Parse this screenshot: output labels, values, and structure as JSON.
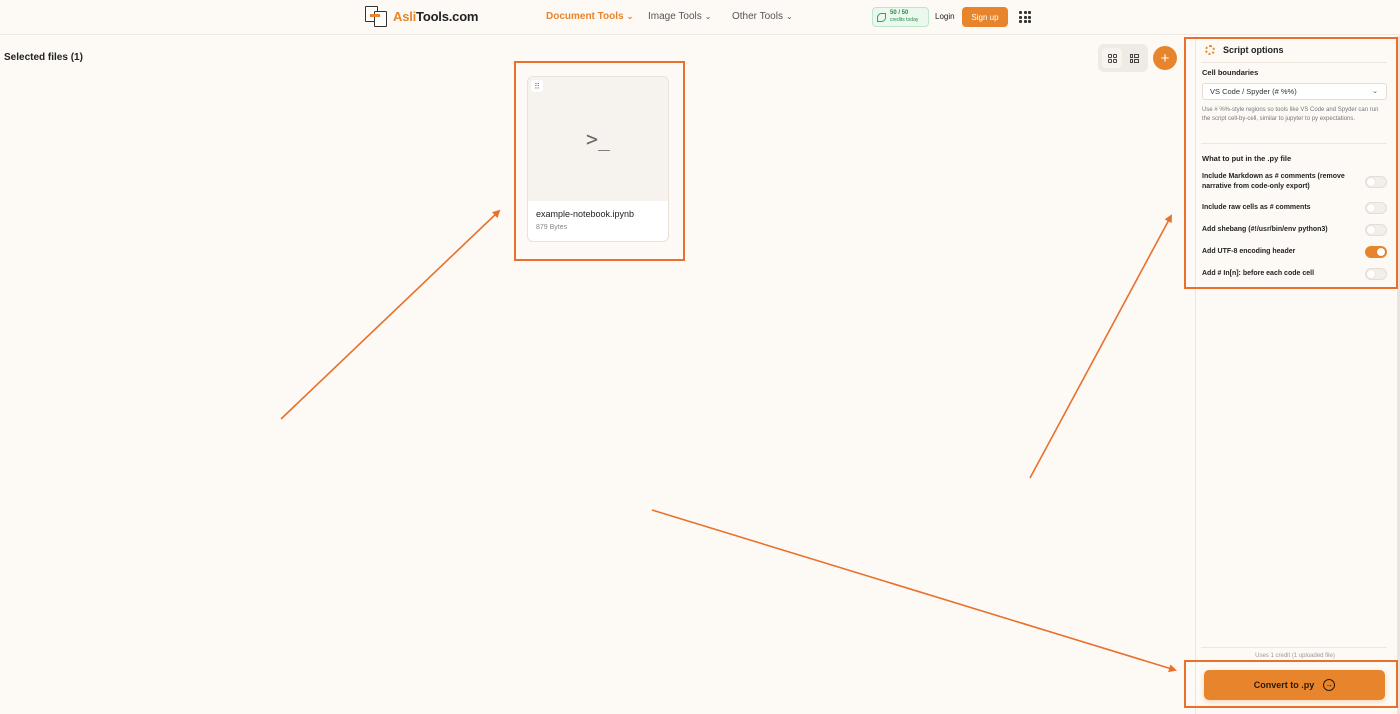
{
  "header": {
    "logo_prefix": "Asli",
    "logo_suffix": "Tools.com",
    "nav": [
      {
        "label": "Document Tools"
      },
      {
        "label": "Image Tools"
      },
      {
        "label": "Other Tools"
      }
    ],
    "credits_count": "50 / 50",
    "credits_sub": "credits today",
    "login_label": "Login",
    "signup_label": "Sign up"
  },
  "main": {
    "selected_title": "Selected files (1)",
    "file": {
      "name": "example-notebook.ipynb",
      "size": "879 Bytes",
      "preview_glyph": ">_"
    }
  },
  "panel": {
    "title": "Script options",
    "cell_boundaries_label": "Cell boundaries",
    "cell_boundaries_value": "VS Code / Spyder (# %%)",
    "cell_boundaries_hint": "Use # %%-style regions so tools like VS Code and Spyder can run the script cell-by-cell, similar to jupyter to py expectations.",
    "section_label": "What to put in the .py file",
    "options": [
      {
        "label": "Include Markdown as # comments (remove narrative from code-only export)",
        "on": false
      },
      {
        "label": "Include raw cells as # comments",
        "on": false
      },
      {
        "label": "Add shebang (#!/usr/bin/env python3)",
        "on": false
      },
      {
        "label": "Add UTF-8 encoding header",
        "on": true
      },
      {
        "label": "Add # In[n]: before each code cell",
        "on": false
      }
    ],
    "uses_note": "Uses 1 credit (1 uploaded file)",
    "convert_label": "Convert to .py"
  },
  "colors": {
    "accent": "#e8852c",
    "highlight": "#e8702c",
    "background": "#fdfaf6"
  }
}
